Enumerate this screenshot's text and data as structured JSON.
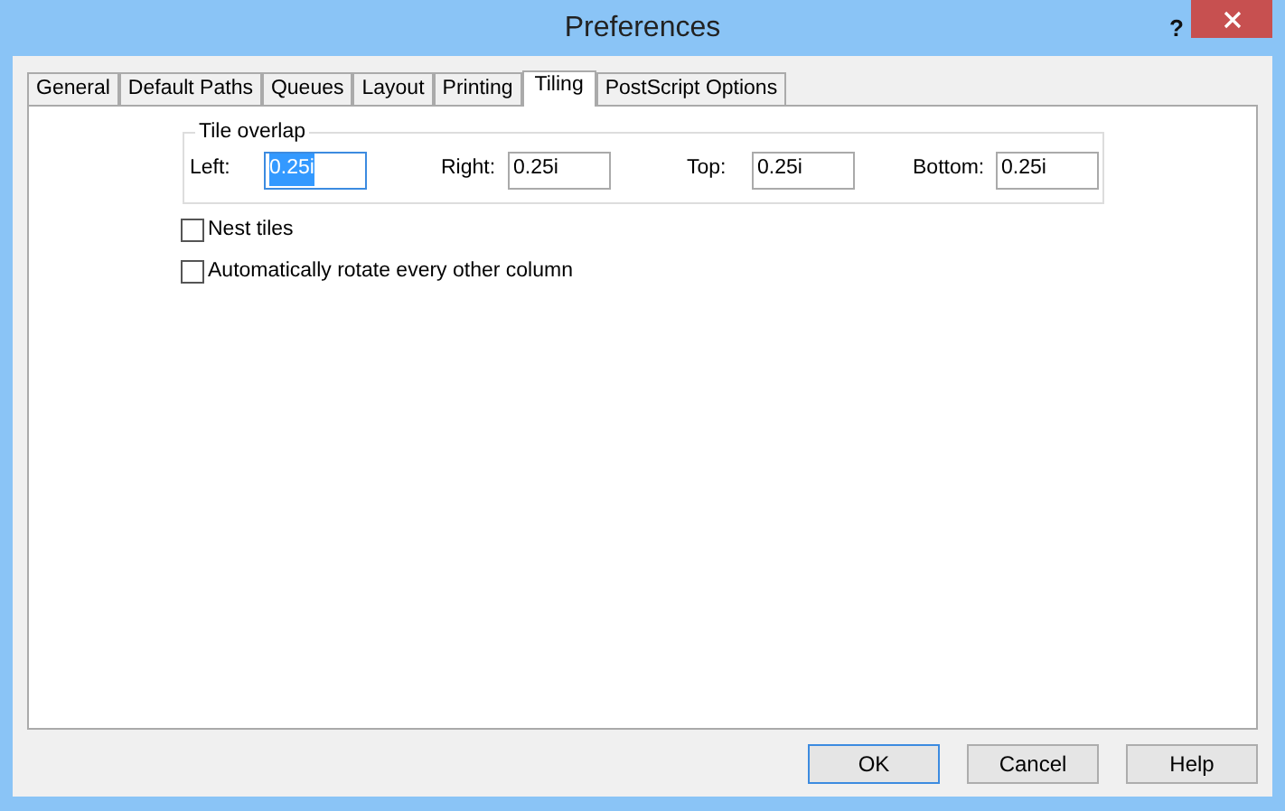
{
  "window": {
    "title": "Preferences",
    "help_glyph": "?"
  },
  "tabs": [
    {
      "label": "General",
      "selected": false
    },
    {
      "label": "Default Paths",
      "selected": false
    },
    {
      "label": "Queues",
      "selected": false
    },
    {
      "label": "Layout",
      "selected": false
    },
    {
      "label": "Printing",
      "selected": false
    },
    {
      "label": "Tiling",
      "selected": true
    },
    {
      "label": "PostScript Options",
      "selected": false
    }
  ],
  "tile_overlap": {
    "title": "Tile overlap",
    "fields": [
      {
        "label": "Left:",
        "value": "0.25i",
        "focused": true
      },
      {
        "label": "Right:",
        "value": "0.25i",
        "focused": false
      },
      {
        "label": "Top:",
        "value": "0.25i",
        "focused": false
      },
      {
        "label": "Bottom:",
        "value": "0.25i",
        "focused": false
      }
    ]
  },
  "options": [
    {
      "label": "Nest tiles",
      "checked": false
    },
    {
      "label": "Automatically rotate every other column",
      "checked": false
    }
  ],
  "buttons": [
    {
      "label": "OK",
      "default": true
    },
    {
      "label": "Cancel",
      "default": false
    },
    {
      "label": "Help",
      "default": false
    }
  ]
}
